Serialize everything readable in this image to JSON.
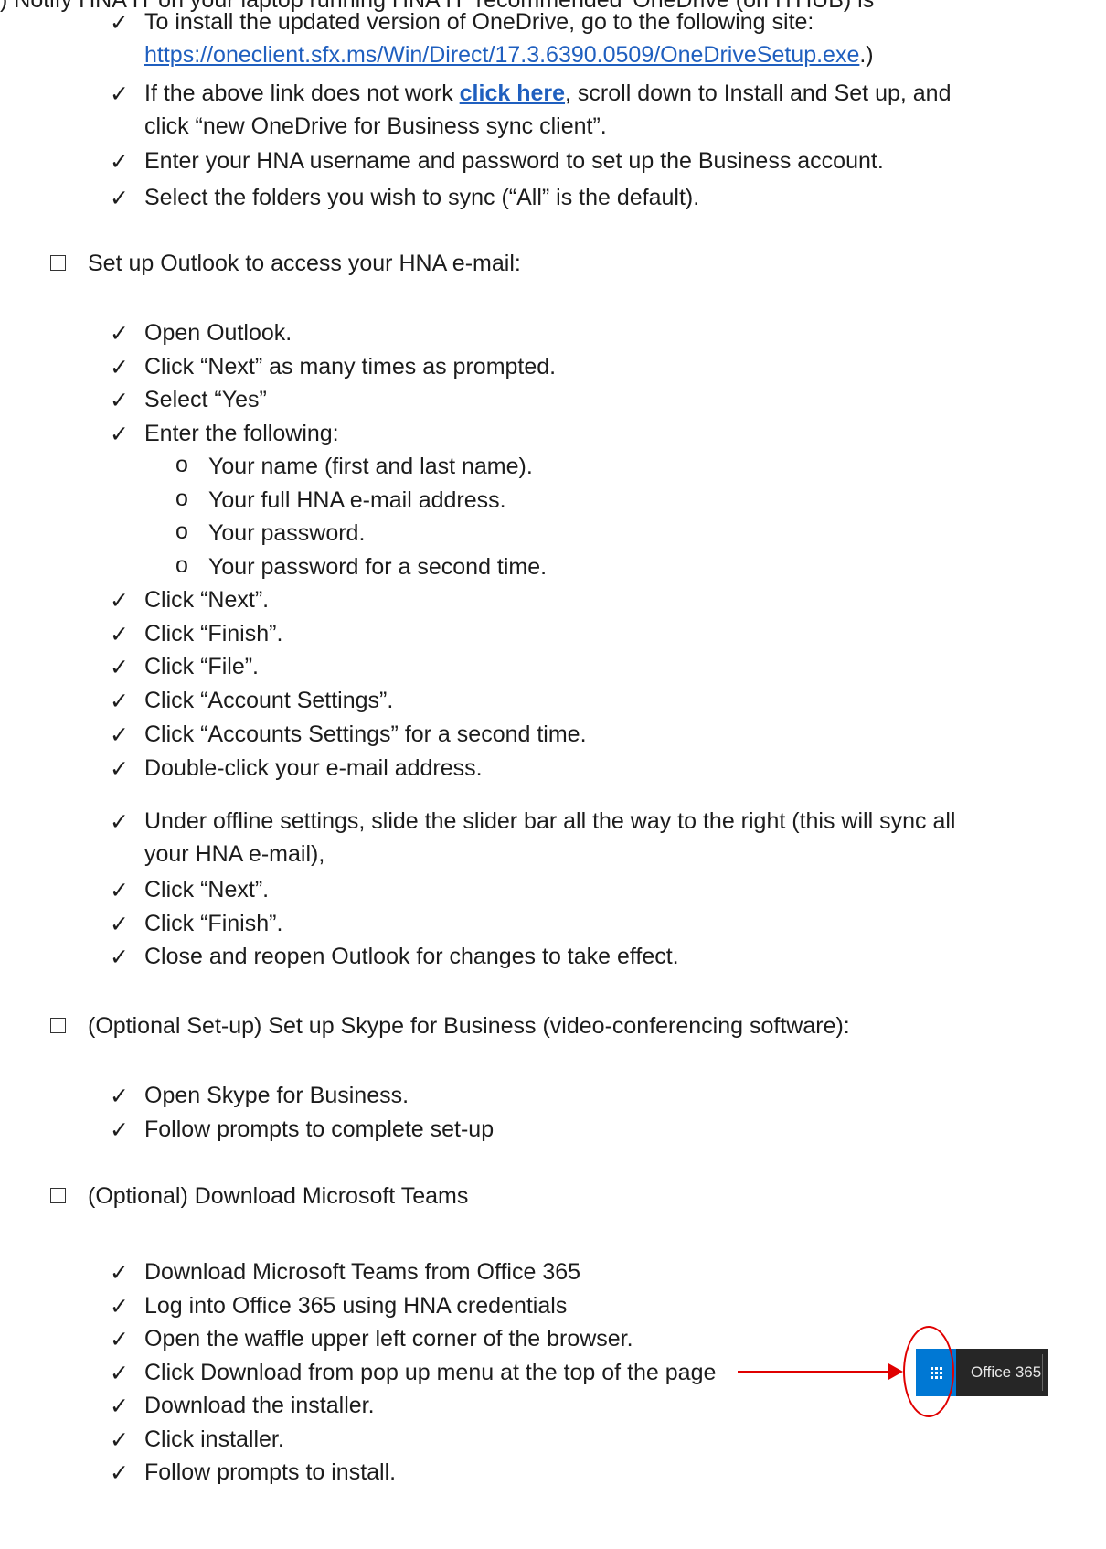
{
  "check_glyph": "✓",
  "top_cut": ") Notify HNA IT on your laptop running HNA IT 'recommended' OneDrive (on ITHUB) is",
  "onedrive": {
    "install_text": "To install the updated version of OneDrive, go to the following site:",
    "url": "https://oneclient.sfx.ms/Win/Direct/17.3.6390.0509/OneDriveSetup.exe",
    "url_suffix": ".)",
    "if_text": "If the above link does not work ",
    "click_here": "click here",
    "if_text_rest": ", scroll down to Install and Set up, and",
    "if_text_line2": "click “new OneDrive for Business sync client”.",
    "enter_text": "Enter your HNA username and password to set up the Business account.",
    "select_text": "Select the folders you wish to sync (“All” is the default)."
  },
  "outlook": {
    "heading": "Set up Outlook to access your HNA e-mail:",
    "steps_a": [
      "Open Outlook.",
      "Click “Next” as many times as prompted.",
      "Select “Yes”",
      "Enter the following:"
    ],
    "sub_bullet": "o",
    "sub": [
      "Your name (first and last name).",
      "Your full HNA e-mail address.",
      "Your password.",
      "Your password for a second time."
    ],
    "steps_b": [
      "Click “Next”.",
      "Click “Finish”.",
      "Click “File”.",
      "Click “Account Settings”.",
      "Click “Accounts Settings” for a second time.",
      "Double-click your e-mail address."
    ],
    "slider_line1": "Under offline settings, slide the slider bar all the way to the right (this will sync all",
    "slider_line2": "your HNA e-mail),",
    "steps_c": [
      "Click “Next”.",
      "Click “Finish”.",
      "Close and reopen Outlook for changes to take effect."
    ]
  },
  "skype": {
    "heading": "(Optional Set-up) Set up Skype for Business (video-conferencing software):",
    "steps": [
      "Open Skype for Business.",
      "Follow prompts to complete set-up"
    ]
  },
  "teams": {
    "heading": "(Optional) Download Microsoft Teams",
    "steps": [
      "Download Microsoft Teams from Office 365",
      "Log into Office 365 using HNA credentials",
      "Open the waffle upper left corner of the browser.",
      "Click Download from pop up menu at the top of the page",
      "Download the installer.",
      "Click installer.",
      "Follow prompts to install."
    ]
  },
  "office365_badge": {
    "label": "Office 365",
    "tile_color": "#0078d4",
    "bar_color": "#262626",
    "annotation_color": "#e00000"
  },
  "link_color": "#1f5fbf"
}
